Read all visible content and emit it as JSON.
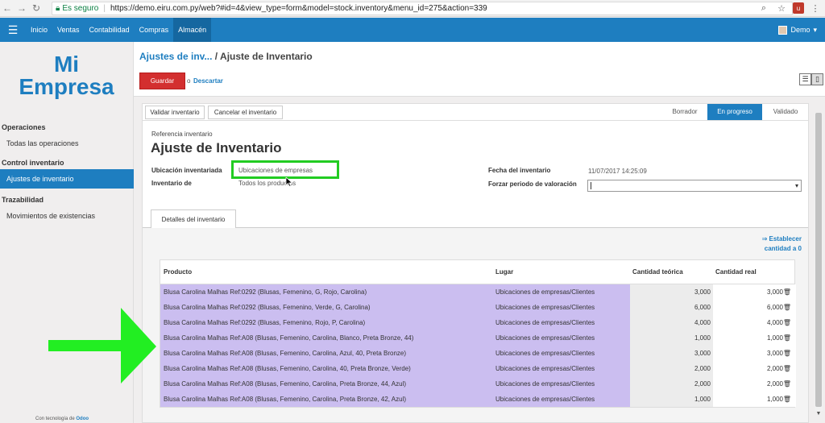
{
  "browser": {
    "secure_label": "Es seguro",
    "url": "https://demo.eiru.com.py/web?#id=4&view_type=form&model=stock.inventory&menu_id=275&action=339",
    "ext_label": "u"
  },
  "topnav": {
    "items": [
      "Inicio",
      "Ventas",
      "Contabilidad",
      "Compras",
      "Almacén"
    ],
    "active": "Almacén",
    "user": "Demo"
  },
  "sidebar": {
    "logo_line1": "Mi",
    "logo_line2": "Empresa",
    "sections": [
      {
        "title": "Operaciones",
        "items": [
          "Todas las operaciones"
        ]
      },
      {
        "title": "Control inventario",
        "items": [
          "Ajustes de inventario"
        ]
      },
      {
        "title": "Trazabilidad",
        "items": [
          "Movimientos de existencias"
        ]
      }
    ],
    "powered_text": "Con tecnología de",
    "powered_brand": "Odoo"
  },
  "control_panel": {
    "breadcrumb_parent": "Ajustes de inv...",
    "breadcrumb_sep": " / ",
    "breadcrumb_current": "Ajuste de Inventario",
    "save_label": "Guardar",
    "or_label": "o",
    "discard_label": "Descartar"
  },
  "statusbar": {
    "validate_label": "Validar inventario",
    "cancel_label": "Cancelar el inventario",
    "stages": [
      "Borrador",
      "En progreso",
      "Validado"
    ],
    "active_stage": "En progreso"
  },
  "form": {
    "ref_label": "Referencia inventario",
    "title": "Ajuste de Inventario",
    "location_label": "Ubicación inventariada",
    "location_value": "Ubicaciones de empresas",
    "inventory_of_label": "Inventario de",
    "inventory_of_value": "Todos los productos",
    "date_label": "Fecha del inventario",
    "date_value": "11/07/2017 14:25:09",
    "force_period_label": "Forzar periodo de valoración",
    "tab_label": "Detalles del inventario",
    "reset_link": "⇒ Establecer cantidad a 0"
  },
  "table": {
    "headers": [
      "Producto",
      "Lugar",
      "Cantidad teórica",
      "Cantidad real"
    ],
    "rows": [
      {
        "product": "Blusa Carolina Malhas Ref:0292 (Blusas, Femenino, G, Rojo, Carolina)",
        "location": "Ubicaciones de empresas/Clientes",
        "theoretical": "3,000",
        "real": "3,000"
      },
      {
        "product": "Blusa Carolina Malhas Ref:0292 (Blusas, Femenino, Verde, G, Carolina)",
        "location": "Ubicaciones de empresas/Clientes",
        "theoretical": "6,000",
        "real": "6,000"
      },
      {
        "product": "Blusa Carolina Malhas Ref:0292 (Blusas, Femenino, Rojo, P, Carolina)",
        "location": "Ubicaciones de empresas/Clientes",
        "theoretical": "4,000",
        "real": "4,000"
      },
      {
        "product": "Blusa Carolina Malhas Ref:A08 (Blusas, Femenino, Carolina, Blanco, Preta Bronze, 44)",
        "location": "Ubicaciones de empresas/Clientes",
        "theoretical": "1,000",
        "real": "1,000"
      },
      {
        "product": "Blusa Carolina Malhas Ref:A08 (Blusas, Femenino, Carolina, Azul, 40, Preta Bronze)",
        "location": "Ubicaciones de empresas/Clientes",
        "theoretical": "3,000",
        "real": "3,000"
      },
      {
        "product": "Blusa Carolina Malhas Ref:A08 (Blusas, Femenino, Carolina, 40, Preta Bronze, Verde)",
        "location": "Ubicaciones de empresas/Clientes",
        "theoretical": "2,000",
        "real": "2,000"
      },
      {
        "product": "Blusa Carolina Malhas Ref:A08 (Blusas, Femenino, Carolina, Preta Bronze, 44, Azul)",
        "location": "Ubicaciones de empresas/Clientes",
        "theoretical": "2,000",
        "real": "2,000"
      },
      {
        "product": "Blusa Carolina Malhas Ref:A08 (Blusas, Femenino, Carolina, Preta Bronze, 42, Azul)",
        "location": "Ubicaciones de empresas/Clientes",
        "theoretical": "1,000",
        "real": "1,000"
      }
    ]
  },
  "icons": {
    "back": "arrow-left-icon",
    "forward": "arrow-right-icon",
    "reload": "reload-icon",
    "lock": "lock-icon",
    "zoom": "zoom-icon",
    "star": "star-icon",
    "menu": "hamburger-icon",
    "delete": "trash-icon",
    "list_view": "list-view-icon",
    "form_view": "form-view-icon"
  },
  "colors": {
    "brand": "#1e7ec0",
    "save": "#d32f2f",
    "row_highlight": "#cbbef0",
    "annotation": "#22cc22"
  }
}
